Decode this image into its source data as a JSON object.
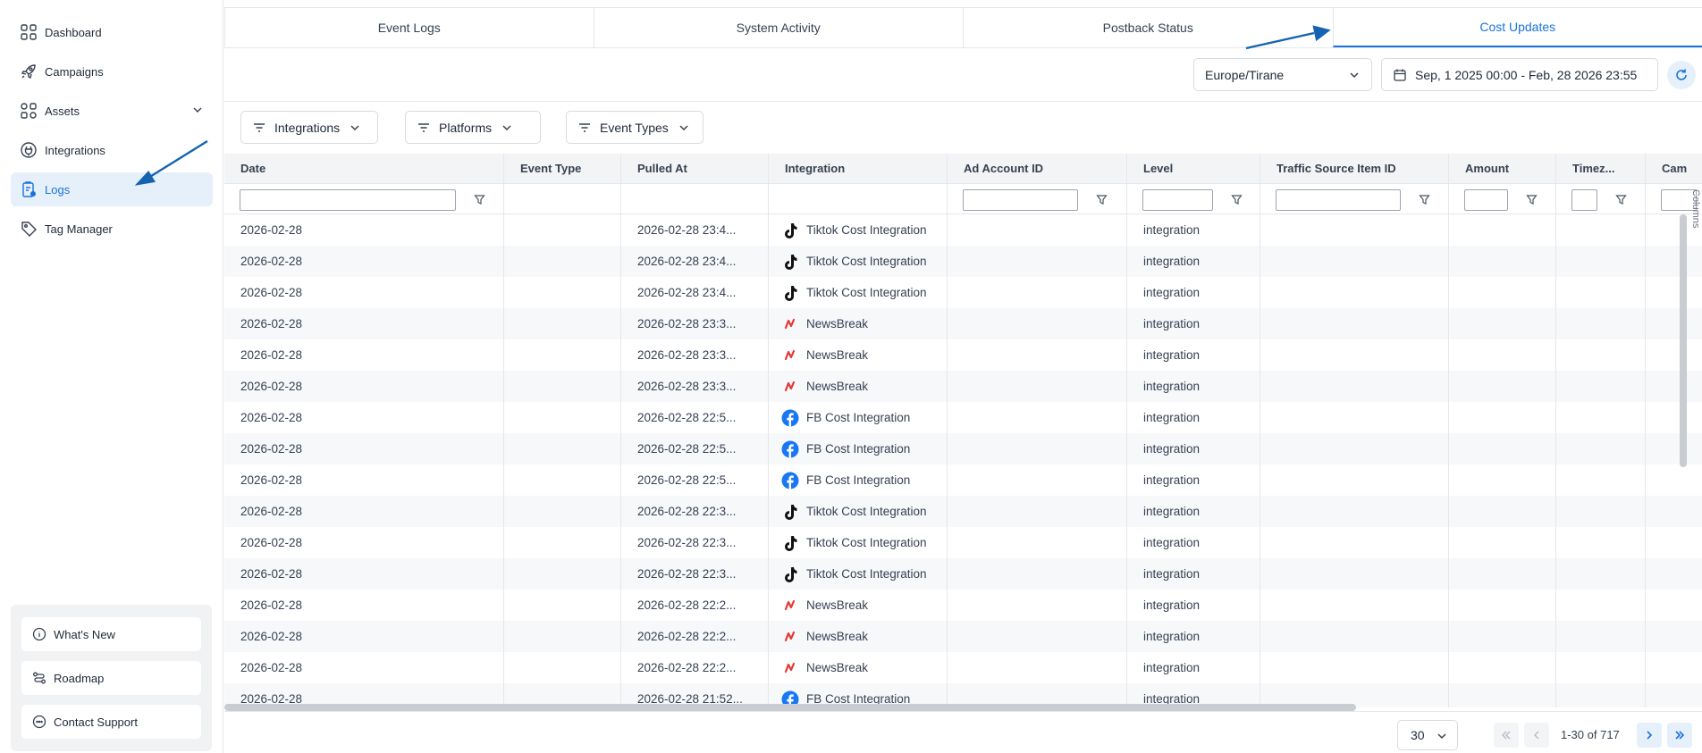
{
  "sidebar": {
    "items": [
      {
        "label": "Dashboard",
        "icon": "grid-icon"
      },
      {
        "label": "Campaigns",
        "icon": "rocket-icon"
      },
      {
        "label": "Assets",
        "icon": "grid-icon"
      },
      {
        "label": "Integrations",
        "icon": "plug-icon"
      },
      {
        "label": "Logs",
        "icon": "clipboard-icon"
      },
      {
        "label": "Tag Manager",
        "icon": "tag-icon"
      }
    ],
    "help": [
      {
        "label": "What's New"
      },
      {
        "label": "Roadmap"
      },
      {
        "label": "Contact Support"
      }
    ]
  },
  "tabs": [
    {
      "label": "Event Logs"
    },
    {
      "label": "System Activity"
    },
    {
      "label": "Postback Status"
    },
    {
      "label": "Cost Updates"
    }
  ],
  "toolbar": {
    "timezone": "Europe/Tirane",
    "date_range": "Sep, 1 2025 00:00 - Feb, 28 2026 23:55"
  },
  "filters": [
    {
      "label": "Integrations"
    },
    {
      "label": "Platforms"
    },
    {
      "label": "Event Types"
    }
  ],
  "table": {
    "columns": [
      "Date",
      "Event Type",
      "Pulled At",
      "Integration",
      "Ad Account ID",
      "Level",
      "Traffic Source Item ID",
      "Amount",
      "Timez...",
      "Cam"
    ],
    "side_label": "Columns",
    "rows": [
      {
        "date": "2026-02-28",
        "pulled_at": "2026-02-28 23:4...",
        "integration": "Tiktok Cost Integration",
        "icon": "tiktok-icon",
        "level": "integration"
      },
      {
        "date": "2026-02-28",
        "pulled_at": "2026-02-28 23:4...",
        "integration": "Tiktok Cost Integration",
        "icon": "tiktok-icon",
        "level": "integration"
      },
      {
        "date": "2026-02-28",
        "pulled_at": "2026-02-28 23:4...",
        "integration": "Tiktok Cost Integration",
        "icon": "tiktok-icon",
        "level": "integration"
      },
      {
        "date": "2026-02-28",
        "pulled_at": "2026-02-28 23:3...",
        "integration": "NewsBreak",
        "icon": "newsbreak-icon",
        "level": "integration"
      },
      {
        "date": "2026-02-28",
        "pulled_at": "2026-02-28 23:3...",
        "integration": "NewsBreak",
        "icon": "newsbreak-icon",
        "level": "integration"
      },
      {
        "date": "2026-02-28",
        "pulled_at": "2026-02-28 23:3...",
        "integration": "NewsBreak",
        "icon": "newsbreak-icon",
        "level": "integration"
      },
      {
        "date": "2026-02-28",
        "pulled_at": "2026-02-28 22:5...",
        "integration": "FB Cost Integration",
        "icon": "facebook-icon",
        "level": "integration"
      },
      {
        "date": "2026-02-28",
        "pulled_at": "2026-02-28 22:5...",
        "integration": "FB Cost Integration",
        "icon": "facebook-icon",
        "level": "integration"
      },
      {
        "date": "2026-02-28",
        "pulled_at": "2026-02-28 22:5...",
        "integration": "FB Cost Integration",
        "icon": "facebook-icon",
        "level": "integration"
      },
      {
        "date": "2026-02-28",
        "pulled_at": "2026-02-28 22:3...",
        "integration": "Tiktok Cost Integration",
        "icon": "tiktok-icon",
        "level": "integration"
      },
      {
        "date": "2026-02-28",
        "pulled_at": "2026-02-28 22:3...",
        "integration": "Tiktok Cost Integration",
        "icon": "tiktok-icon",
        "level": "integration"
      },
      {
        "date": "2026-02-28",
        "pulled_at": "2026-02-28 22:3...",
        "integration": "Tiktok Cost Integration",
        "icon": "tiktok-icon",
        "level": "integration"
      },
      {
        "date": "2026-02-28",
        "pulled_at": "2026-02-28 22:2...",
        "integration": "NewsBreak",
        "icon": "newsbreak-icon",
        "level": "integration"
      },
      {
        "date": "2026-02-28",
        "pulled_at": "2026-02-28 22:2...",
        "integration": "NewsBreak",
        "icon": "newsbreak-icon",
        "level": "integration"
      },
      {
        "date": "2026-02-28",
        "pulled_at": "2026-02-28 22:2...",
        "integration": "NewsBreak",
        "icon": "newsbreak-icon",
        "level": "integration"
      },
      {
        "date": "2026-02-28",
        "pulled_at": "2026-02-28 21:52...",
        "integration": "FB Cost Integration",
        "icon": "facebook-icon",
        "level": "integration"
      }
    ]
  },
  "pagination": {
    "page_size": "30",
    "range": "1-30 of 717"
  },
  "colors": {
    "accent": "#1a73d9",
    "annotation_arrow": "#1463b0"
  }
}
